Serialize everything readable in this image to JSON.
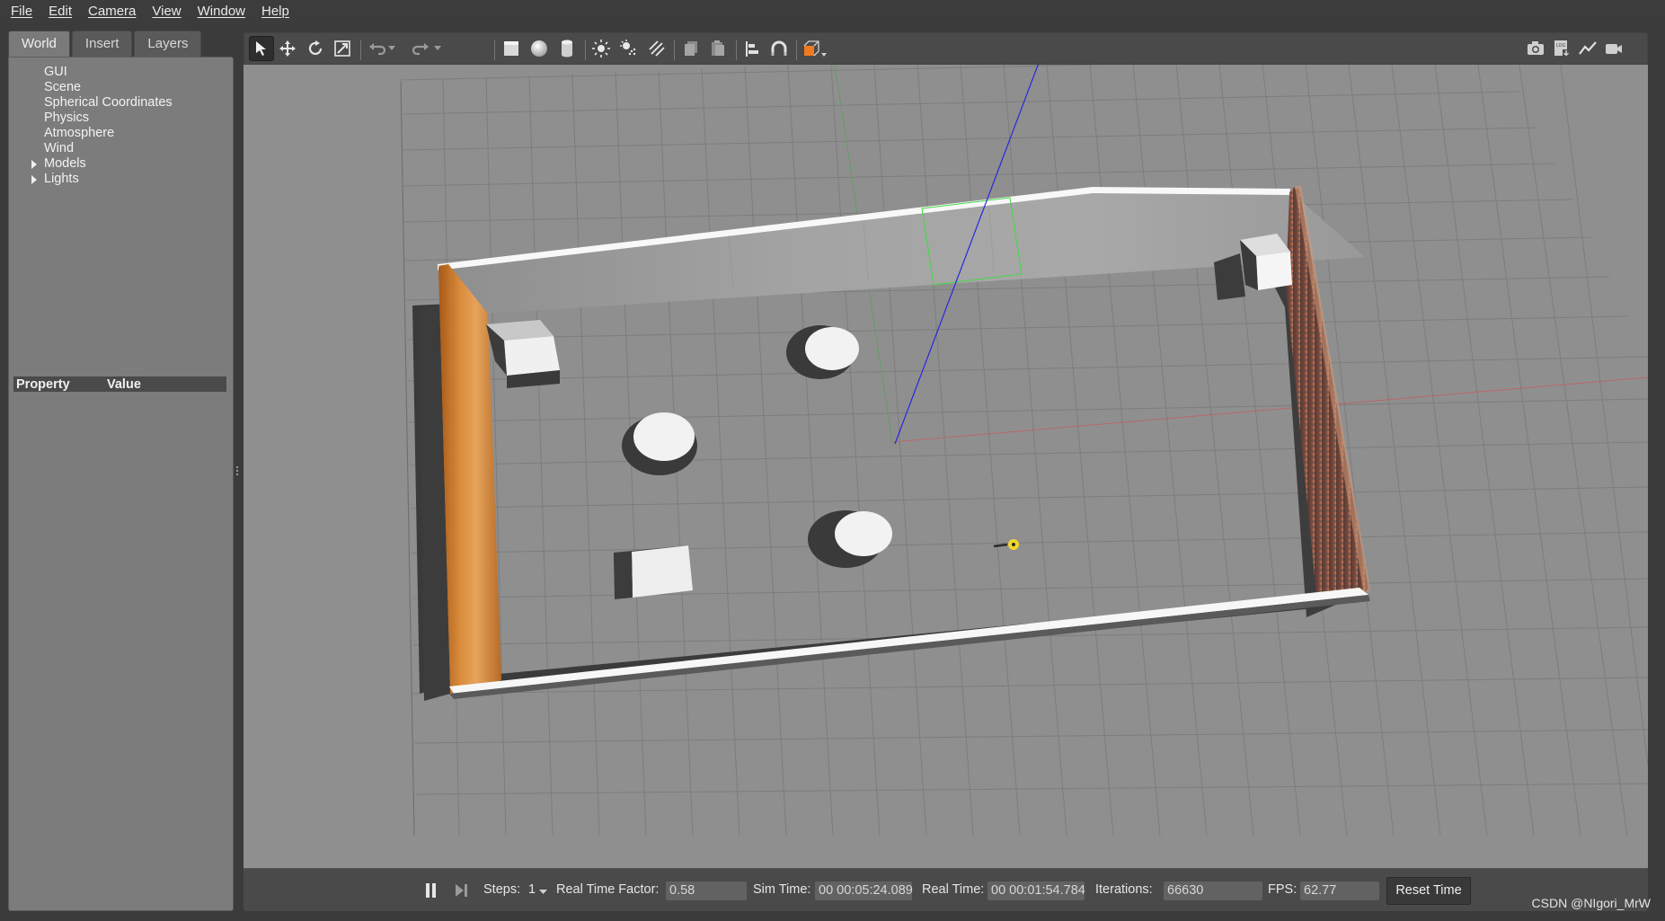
{
  "menu": [
    "File",
    "Edit",
    "Camera",
    "View",
    "Window",
    "Help"
  ],
  "tabs": [
    "World",
    "Insert",
    "Layers"
  ],
  "tree": [
    {
      "label": "GUI",
      "expandable": false
    },
    {
      "label": "Scene",
      "expandable": false
    },
    {
      "label": "Spherical Coordinates",
      "expandable": false
    },
    {
      "label": "Physics",
      "expandable": false
    },
    {
      "label": "Atmosphere",
      "expandable": false
    },
    {
      "label": "Wind",
      "expandable": false
    },
    {
      "label": "Models",
      "expandable": true
    },
    {
      "label": "Lights",
      "expandable": true
    }
  ],
  "properties": {
    "col_property": "Property",
    "col_value": "Value"
  },
  "toolbar_icons": [
    "select-arrow-icon",
    "translate-icon",
    "rotate-icon",
    "scale-icon",
    "undo-icon",
    "redo-icon",
    "box-icon",
    "sphere-icon",
    "cylinder-icon",
    "point-light-icon",
    "spot-light-icon",
    "directional-light-icon",
    "copy-icon",
    "paste-icon",
    "align-icon",
    "snap-icon",
    "view-angle-icon",
    "screenshot-icon",
    "log-icon",
    "plot-icon",
    "record-video-icon"
  ],
  "status": {
    "steps_label": "Steps:",
    "steps_value": "1",
    "rtf_label": "Real Time Factor:",
    "rtf_value": "0.58",
    "sim_time_label": "Sim Time:",
    "sim_time_value": "00 00:05:24.089",
    "real_time_label": "Real Time:",
    "real_time_value": "00 00:01:54.784",
    "iterations_label": "Iterations:",
    "iterations_value": "66630",
    "fps_label": "FPS:",
    "fps_value": "62.77",
    "reset_label": "Reset Time"
  },
  "watermark": "CSDN @NIgori_MrW",
  "colors": {
    "viewport_bg": "#8f8f8f",
    "grid_line": "#7a7a7a",
    "wood_wall": "#c8792e",
    "brick_wall": "#7a4a3a",
    "selection_box": "#3ddc3d",
    "z_axis": "#2828e0",
    "x_axis": "#c04040"
  }
}
